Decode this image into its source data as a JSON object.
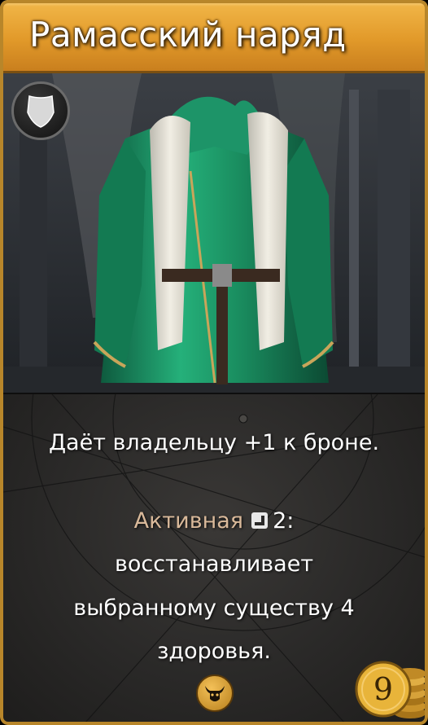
{
  "card": {
    "title": "Рамасский наряд",
    "description": "Даёт владельцу +1 к броне.",
    "active_label": "Активная",
    "active_cost": "2:",
    "active_lines": [
      "восстанавливает",
      "выбранному существу 4",
      "здоровья."
    ],
    "gold_cost": "9"
  },
  "icons": {
    "type": "shield-icon",
    "active_cost": "square-corner-icon",
    "faction": "bull-skull-icon",
    "currency": "gold-coins-icon"
  },
  "colors": {
    "title_bar": "#e29a2a",
    "frame": "#b8862a",
    "active_label": "#d9b99a",
    "robe": "#1f9a6a",
    "coin": "#e8b43a"
  }
}
